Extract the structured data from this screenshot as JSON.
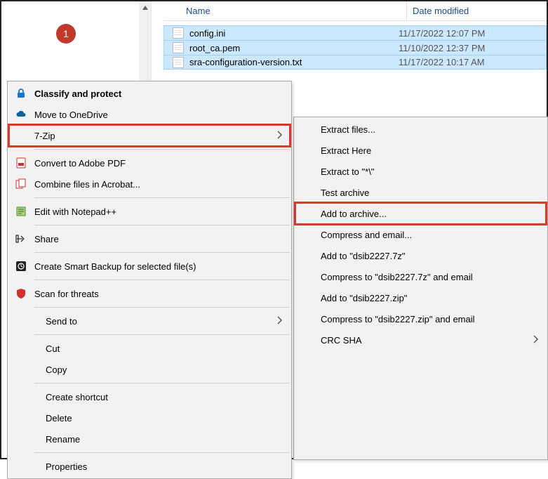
{
  "badge": "1",
  "columns": {
    "name": "Name",
    "date": "Date modified"
  },
  "files": [
    {
      "name": "config.ini",
      "date": "11/17/2022 12:07 PM"
    },
    {
      "name": "root_ca.pem",
      "date": "11/10/2022 12:37 PM"
    },
    {
      "name": "sra-configuration-version.txt",
      "date": "11/17/2022 10:17 AM"
    }
  ],
  "menu": {
    "classify": "Classify and protect",
    "onedrive": "Move to OneDrive",
    "sevenzip": "7-Zip",
    "convertpdf": "Convert to Adobe PDF",
    "combine": "Combine files in Acrobat...",
    "notepad": "Edit with Notepad++",
    "share": "Share",
    "backup": "Create Smart Backup for selected file(s)",
    "scan": "Scan for threats",
    "sendto": "Send to",
    "cut": "Cut",
    "copy": "Copy",
    "shortcut": "Create shortcut",
    "delete": "Delete",
    "rename": "Rename",
    "properties": "Properties"
  },
  "submenu": {
    "extractfiles": "Extract files...",
    "extracthere": "Extract Here",
    "extractto": "Extract to \"*\\\"",
    "test": "Test archive",
    "addarchive": "Add to archive...",
    "compressemail": "Compress and email...",
    "addto7z": "Add to \"dsib2227.7z\"",
    "compress7zemail": "Compress to \"dsib2227.7z\" and email",
    "addtozip": "Add to \"dsib2227.zip\"",
    "compresszipemail": "Compress to \"dsib2227.zip\" and email",
    "crcsha": "CRC SHA"
  }
}
